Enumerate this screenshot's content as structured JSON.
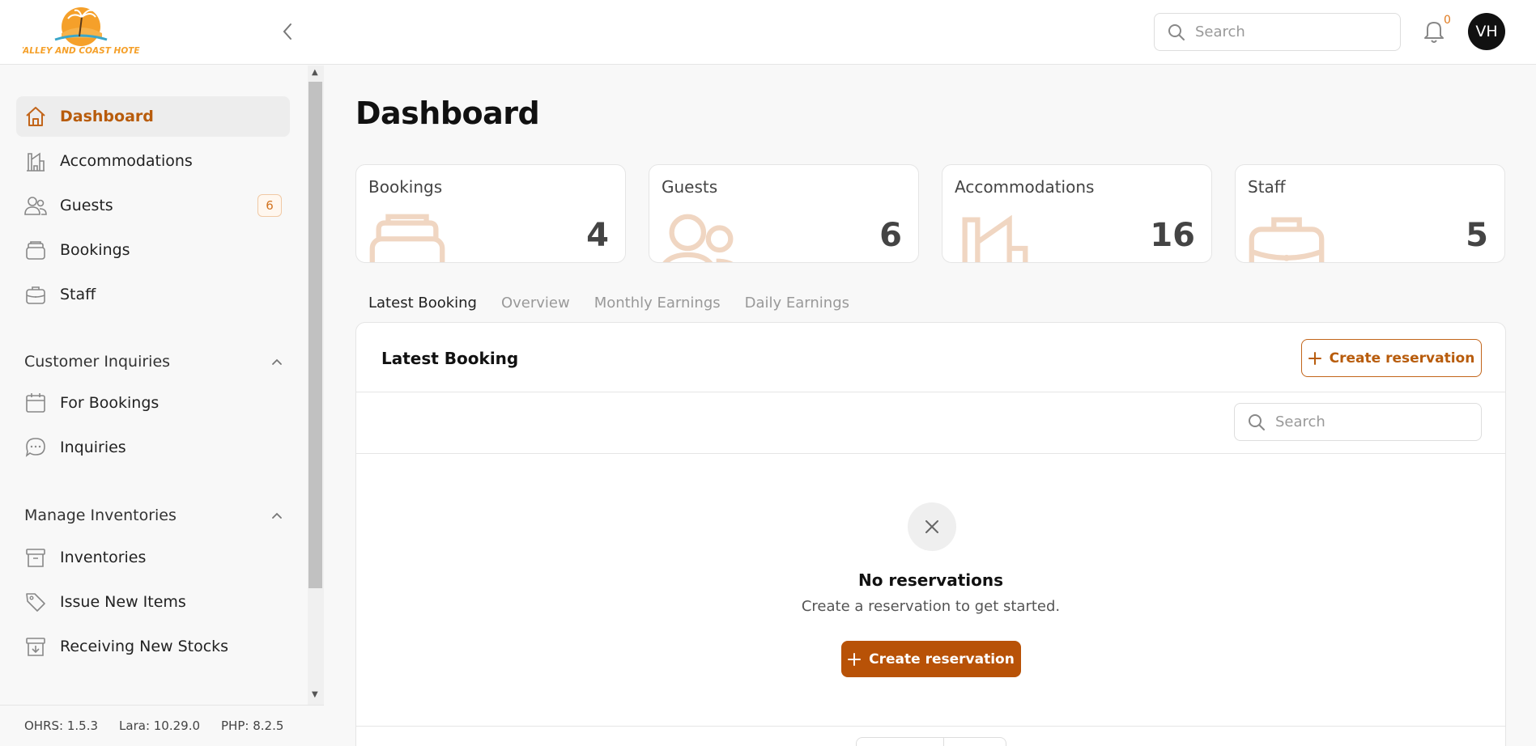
{
  "header": {
    "logo_text": "VALLEY AND COAST HOTEL",
    "search_placeholder": "Search",
    "notification_count": "0",
    "avatar_initials": "VH"
  },
  "sidebar": {
    "main_items": [
      {
        "label": "Dashboard",
        "icon": "home-icon",
        "active": true
      },
      {
        "label": "Accommodations",
        "icon": "building-icon"
      },
      {
        "label": "Guests",
        "icon": "users-icon",
        "badge": "6"
      },
      {
        "label": "Bookings",
        "icon": "stack-icon"
      },
      {
        "label": "Staff",
        "icon": "briefcase-icon"
      }
    ],
    "sections": [
      {
        "title": "Customer Inquiries",
        "items": [
          {
            "label": "For Bookings",
            "icon": "calendar-icon"
          },
          {
            "label": "Inquiries",
            "icon": "chat-icon"
          }
        ]
      },
      {
        "title": "Manage Inventories",
        "items": [
          {
            "label": "Inventories",
            "icon": "archive-icon"
          },
          {
            "label": "Issue New Items",
            "icon": "tag-icon"
          },
          {
            "label": "Receiving New Stocks",
            "icon": "archive-down-icon"
          }
        ]
      }
    ],
    "versions": [
      "OHRS: 1.5.3",
      "Lara: 10.29.0",
      "PHP: 8.2.5"
    ]
  },
  "main": {
    "title": "Dashboard",
    "stats": [
      {
        "label": "Bookings",
        "value": "4",
        "icon": "stack-icon"
      },
      {
        "label": "Guests",
        "value": "6",
        "icon": "users-icon"
      },
      {
        "label": "Accommodations",
        "value": "16",
        "icon": "building-icon"
      },
      {
        "label": "Staff",
        "value": "5",
        "icon": "briefcase-icon"
      }
    ],
    "tabs": [
      {
        "label": "Latest Booking",
        "active": true
      },
      {
        "label": "Overview"
      },
      {
        "label": "Monthly Earnings"
      },
      {
        "label": "Daily Earnings"
      }
    ],
    "panel": {
      "title": "Latest Booking",
      "create_label": "Create reservation",
      "search_placeholder": "Search",
      "empty_title": "No reservations",
      "empty_subtitle": "Create a reservation to get started.",
      "empty_button_label": "Create reservation"
    }
  },
  "colors": {
    "accent": "#b85207",
    "accent_light": "#f0d6c2",
    "badge_text": "#d27320"
  }
}
